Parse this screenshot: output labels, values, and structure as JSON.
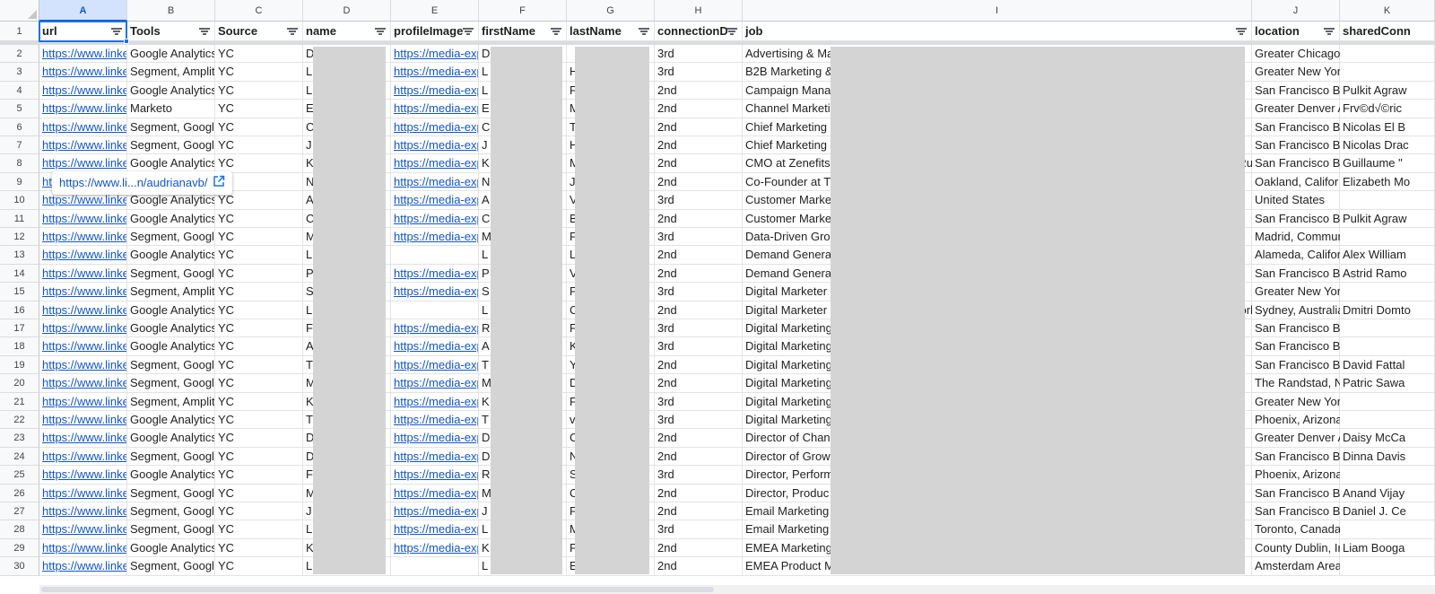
{
  "columns": [
    {
      "letter": "A",
      "header": "url"
    },
    {
      "letter": "B",
      "header": "Tools"
    },
    {
      "letter": "C",
      "header": "Source"
    },
    {
      "letter": "D",
      "header": "name"
    },
    {
      "letter": "E",
      "header": "profileImage"
    },
    {
      "letter": "F",
      "header": "firstName"
    },
    {
      "letter": "G",
      "header": "lastName"
    },
    {
      "letter": "H",
      "header": "connectionD"
    },
    {
      "letter": "I",
      "header": "job"
    },
    {
      "letter": "J",
      "header": "location"
    },
    {
      "letter": "K",
      "header": "sharedConn"
    }
  ],
  "rows": [
    {
      "num": "2",
      "url": "https://www.linke",
      "tools": "Google Analytics",
      "source": "YC",
      "name": "D",
      "profileImage": "https://media-exp",
      "firstName": "D",
      "lastName": "",
      "connection": "3rd",
      "job": "Advertising & Ma",
      "location": "Greater Chicago Area",
      "shared": ""
    },
    {
      "num": "3",
      "url": "https://www.linke",
      "tools": "Segment, Amplit",
      "source": "YC",
      "name": "L",
      "profileImage": "https://media-exp",
      "firstName": "L",
      "lastName": "H",
      "connection": "3rd",
      "job": "B2B Marketing &",
      "location": "Greater New York City Area",
      "shared": ""
    },
    {
      "num": "4",
      "url": "https://www.linke",
      "tools": "Google Analytics",
      "source": "YC",
      "name": "L",
      "profileImage": "https://media-exp",
      "firstName": "L",
      "lastName": "F",
      "connection": "2nd",
      "job": "Campaign Mana",
      "location": "San Francisco B",
      "shared": "Pulkit Agraw"
    },
    {
      "num": "5",
      "url": "https://www.linke",
      "tools": "Marketo",
      "source": "YC",
      "name": "E",
      "nameTail": "rin",
      "profileImage": "https://media-exp",
      "firstName": "E",
      "lastName": "M",
      "connection": "2nd",
      "job": "Channel Marketi",
      "location": "Greater Denver A",
      "shared": "Frv©d√©ric"
    },
    {
      "num": "6",
      "url": "https://www.linke",
      "tools": "Segment, Google",
      "source": "YC",
      "name": "C",
      "profileImage": "https://media-exp",
      "firstName": "C",
      "lastName": "T",
      "connection": "2nd",
      "job": "Chief Marketing",
      "location": "San Francisco B",
      "shared": "Nicolas El B"
    },
    {
      "num": "7",
      "url": "https://www.linke",
      "tools": "Segment, Google",
      "source": "YC",
      "name": "J",
      "nameTail": "n",
      "profileImage": "https://media-exp",
      "firstName": "J",
      "lastName": "H",
      "connection": "2nd",
      "job": "Chief Marketing",
      "location": "San Francisco B",
      "shared": "Nicolas Drac"
    },
    {
      "num": "8",
      "url": "https://www.linke",
      "tools": "Google Analytics",
      "source": "YC",
      "name": "K",
      "profileImage": "https://media-exp",
      "firstName": "K",
      "lastName": "M",
      "connection": "2nd",
      "job": "CMO at Zenefits",
      "jobTail": "Ru",
      "location": "San Francisco B",
      "shared": "Guillaume \""
    },
    {
      "num": "9",
      "url": "ht",
      "tools": "",
      "source": "",
      "name": "N",
      "profileImage": "https://media-exp",
      "firstName": "N",
      "lastName": "J",
      "connection": "2nd",
      "job": "Co-Founder at T",
      "location": "Oakland, Califor",
      "shared": "Elizabeth Mo"
    },
    {
      "num": "10",
      "url": "https://www.linke",
      "tools": "Google Analytics",
      "source": "YC",
      "name": "A",
      "nameTail": "vi",
      "profileImage": "https://media-exp",
      "firstName": "A",
      "lastName": "V",
      "lastTail": "a",
      "connection": "3rd",
      "job": "Customer Marke",
      "location": "United States",
      "shared": ""
    },
    {
      "num": "11",
      "url": "https://www.linke",
      "tools": "Google Analytics",
      "source": "YC",
      "name": "C",
      "profileImage": "https://media-exp",
      "firstName": "C",
      "lastName": "B",
      "connection": "2nd",
      "job": "Customer Marke",
      "location": "San Francisco B",
      "shared": "Pulkit Agraw"
    },
    {
      "num": "12",
      "url": "https://www.linke",
      "tools": "Segment, Google",
      "source": "YC",
      "name": "M",
      "profileImage": "https://media-exp",
      "firstName": "M",
      "lastName": "F",
      "connection": "3rd",
      "job": "Data-Driven Gro",
      "location": "Madrid, Community of Madrid",
      "shared": ""
    },
    {
      "num": "13",
      "url": "https://www.linke",
      "tools": "Google Analytics",
      "source": "YC",
      "name": "L",
      "profileImage": "",
      "firstName": "L",
      "lastName": "L",
      "connection": "2nd",
      "job": "Demand Genera",
      "location": "Alameda, Califor",
      "shared": "Alex William"
    },
    {
      "num": "14",
      "url": "https://www.linke",
      "tools": "Segment, Google",
      "source": "YC",
      "name": "P",
      "nameTail": "lv",
      "profileImage": "https://media-exp",
      "firstName": "P",
      "lastName": "V",
      "connection": "2nd",
      "job": "Demand Genera",
      "location": "San Francisco B",
      "shared": "Astrid Ramo"
    },
    {
      "num": "15",
      "url": "https://www.linke",
      "tools": "Segment, Amplit",
      "source": "YC",
      "name": "S",
      "profileImage": "https://media-exp",
      "firstName": "S",
      "lastName": "F",
      "connection": "3rd",
      "job": "Digital Marketer",
      "location": "Greater New York City Area",
      "shared": ""
    },
    {
      "num": "16",
      "url": "https://www.linke",
      "tools": "Google Analytics",
      "source": "YC",
      "name": "L",
      "profileImage": "",
      "firstName": "L",
      "lastName": "C",
      "connection": "2nd",
      "job": "Digital Marketer",
      "jobTail": "orl",
      "location": "Sydney, Australia",
      "shared": "Dmitri Domto"
    },
    {
      "num": "17",
      "url": "https://www.linke",
      "tools": "Google Analytics",
      "source": "YC",
      "name": "F",
      "profileImage": "https://media-exp",
      "firstName": "R",
      "lastName": "F",
      "connection": "3rd",
      "job": "Digital Marketing",
      "location": "San Francisco Bay Area",
      "shared": ""
    },
    {
      "num": "18",
      "url": "https://www.linke",
      "tools": "Google Analytics",
      "source": "YC",
      "name": "A",
      "profileImage": "https://media-exp",
      "firstName": "A",
      "lastName": "K",
      "connection": "3rd",
      "job": "Digital Marketing",
      "location": "San Francisco Bay Area",
      "shared": ""
    },
    {
      "num": "19",
      "url": "https://www.linke",
      "tools": "Segment, Google",
      "source": "YC",
      "name": "T",
      "profileImage": "https://media-exp",
      "firstName": "T",
      "lastName": "Y",
      "connection": "2nd",
      "job": "Digital Marketing",
      "location": "San Francisco B",
      "shared": "David Fattal"
    },
    {
      "num": "20",
      "url": "https://www.linke",
      "tools": "Segment, Google",
      "source": "YC",
      "name": "M",
      "profileImage": "https://media-exp",
      "firstName": "M",
      "lastName": "D",
      "connection": "2nd",
      "job": "Digital Marketing",
      "location": "The Randstad, N",
      "shared": "Patric Sawa"
    },
    {
      "num": "21",
      "url": "https://www.linke",
      "tools": "Segment, Amplit",
      "source": "YC",
      "name": "K",
      "profileImage": "https://media-exp",
      "firstName": "K",
      "lastName": "F",
      "connection": "3rd",
      "job": "Digital Marketing",
      "location": "Greater New York City Area",
      "shared": ""
    },
    {
      "num": "22",
      "url": "https://www.linke",
      "tools": "Google Analytics",
      "source": "YC",
      "name": "T",
      "nameTail": "p",
      "profileImage": "https://media-exp",
      "firstName": "T",
      "lastName": "v",
      "connection": "3rd",
      "job": "Digital Marketing",
      "location": "Phoenix, Arizona Area",
      "shared": ""
    },
    {
      "num": "23",
      "url": "https://www.linke",
      "tools": "Google Analytics",
      "source": "YC",
      "name": "D",
      "profileImage": "https://media-exp",
      "firstName": "D",
      "lastName": "C",
      "connection": "2nd",
      "job": "Director of Chan",
      "location": "Greater Denver A",
      "shared": "Daisy McCa"
    },
    {
      "num": "24",
      "url": "https://www.linke",
      "tools": "Segment, Google",
      "source": "YC",
      "name": "D",
      "profileImage": "https://media-exp",
      "firstName": "D",
      "lastName": "N",
      "connection": "2nd",
      "job": "Director of Grow",
      "location": "San Francisco B",
      "shared": "Dinna Davis"
    },
    {
      "num": "25",
      "url": "https://www.linke",
      "tools": "Google Analytics",
      "source": "YC",
      "name": "F",
      "nameTail": ",",
      "profileImage": "https://media-exp",
      "firstName": "R",
      "lastName": "S",
      "lastTail": "C",
      "connection": "3rd",
      "job": "Director, Perform",
      "location": "Phoenix, Arizona Area",
      "shared": ""
    },
    {
      "num": "26",
      "url": "https://www.linke",
      "tools": "Segment, Google",
      "source": "YC",
      "name": "M",
      "profileImage": "https://media-exp",
      "firstName": "M",
      "lastName": "C",
      "connection": "2nd",
      "job": "Director, Produc",
      "location": "San Francisco B",
      "shared": "Anand Vijay"
    },
    {
      "num": "27",
      "url": "https://www.linke",
      "tools": "Segment, Google",
      "source": "YC",
      "name": "J",
      "profileImage": "https://media-exp",
      "firstName": "J",
      "lastName": "F",
      "connection": "2nd",
      "job": "Email Marketing",
      "location": "San Francisco B",
      "shared": "Daniel J. Ce"
    },
    {
      "num": "28",
      "url": "https://www.linke",
      "tools": "Segment, Google",
      "source": "YC",
      "name": "L",
      "nameTail": "or",
      "profileImage": "https://media-exp",
      "firstName": "L",
      "lastName": "M",
      "connection": "3rd",
      "job": "Email Marketing",
      "location": "Toronto, Canada Area",
      "shared": ""
    },
    {
      "num": "29",
      "url": "https://www.linke",
      "tools": "Google Analytics",
      "source": "YC",
      "name": "K",
      "profileImage": "https://media-exp",
      "firstName": "K",
      "lastName": "F",
      "connection": "2nd",
      "job": "EMEA Marketing",
      "location": "County Dublin, Ir",
      "shared": "Liam Booga"
    },
    {
      "num": "30",
      "url": "https://www.linke",
      "tools": "Segment, Google",
      "source": "YC",
      "name": "L",
      "nameTail": "n",
      "profileImage": "",
      "firstName": "L",
      "lastName": "E",
      "connection": "2nd",
      "job": "EMEA Product M",
      "location": "Amsterdam Area, Netherlands",
      "shared": ""
    }
  ],
  "tooltip": {
    "text": "https://www.li...n/audrianavb/",
    "icon": "open-external-icon"
  },
  "colors": {
    "link": "#1155cc",
    "selection": "#1a73e8",
    "header_bg": "#f8f9fa",
    "redact": "#d4d4d4"
  }
}
